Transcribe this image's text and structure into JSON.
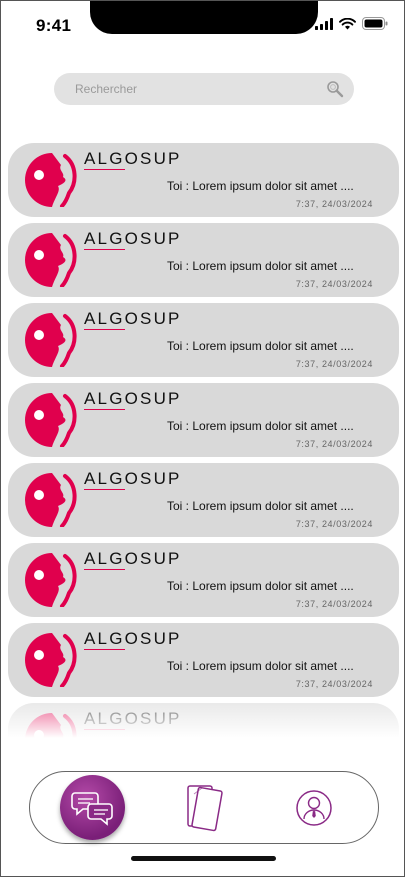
{
  "status_bar": {
    "time": "9:41"
  },
  "search": {
    "placeholder": "Rechercher"
  },
  "conversations": [
    {
      "name": "ALGOSUP",
      "preview": "Toi : Lorem ipsum dolor sit amet ....",
      "timestamp": "7:37, 24/03/2024"
    },
    {
      "name": "ALGOSUP",
      "preview": "Toi : Lorem ipsum dolor sit amet ....",
      "timestamp": "7:37, 24/03/2024"
    },
    {
      "name": "ALGOSUP",
      "preview": "Toi : Lorem ipsum dolor sit amet ....",
      "timestamp": "7:37, 24/03/2024"
    },
    {
      "name": "ALGOSUP",
      "preview": "Toi : Lorem ipsum dolor sit amet ....",
      "timestamp": "7:37, 24/03/2024"
    },
    {
      "name": "ALGOSUP",
      "preview": "Toi : Lorem ipsum dolor sit amet ....",
      "timestamp": "7:37, 24/03/2024"
    },
    {
      "name": "ALGOSUP",
      "preview": "Toi : Lorem ipsum dolor sit amet ....",
      "timestamp": "7:37, 24/03/2024"
    },
    {
      "name": "ALGOSUP",
      "preview": "Toi : Lorem ipsum dolor sit amet ....",
      "timestamp": "7:37, 24/03/2024"
    },
    {
      "name": "ALGOSUP",
      "preview": "",
      "timestamp": ""
    }
  ],
  "nav": {
    "items": [
      {
        "icon": "chat-bubbles-icon",
        "active": true
      },
      {
        "icon": "cards-icon",
        "active": false
      },
      {
        "icon": "profile-icon",
        "active": false
      }
    ]
  },
  "colors": {
    "brand": "#e0004d",
    "accent": "#8a2a86",
    "item_bg": "#d9d9d9",
    "search_bg": "#e2e2e2"
  }
}
